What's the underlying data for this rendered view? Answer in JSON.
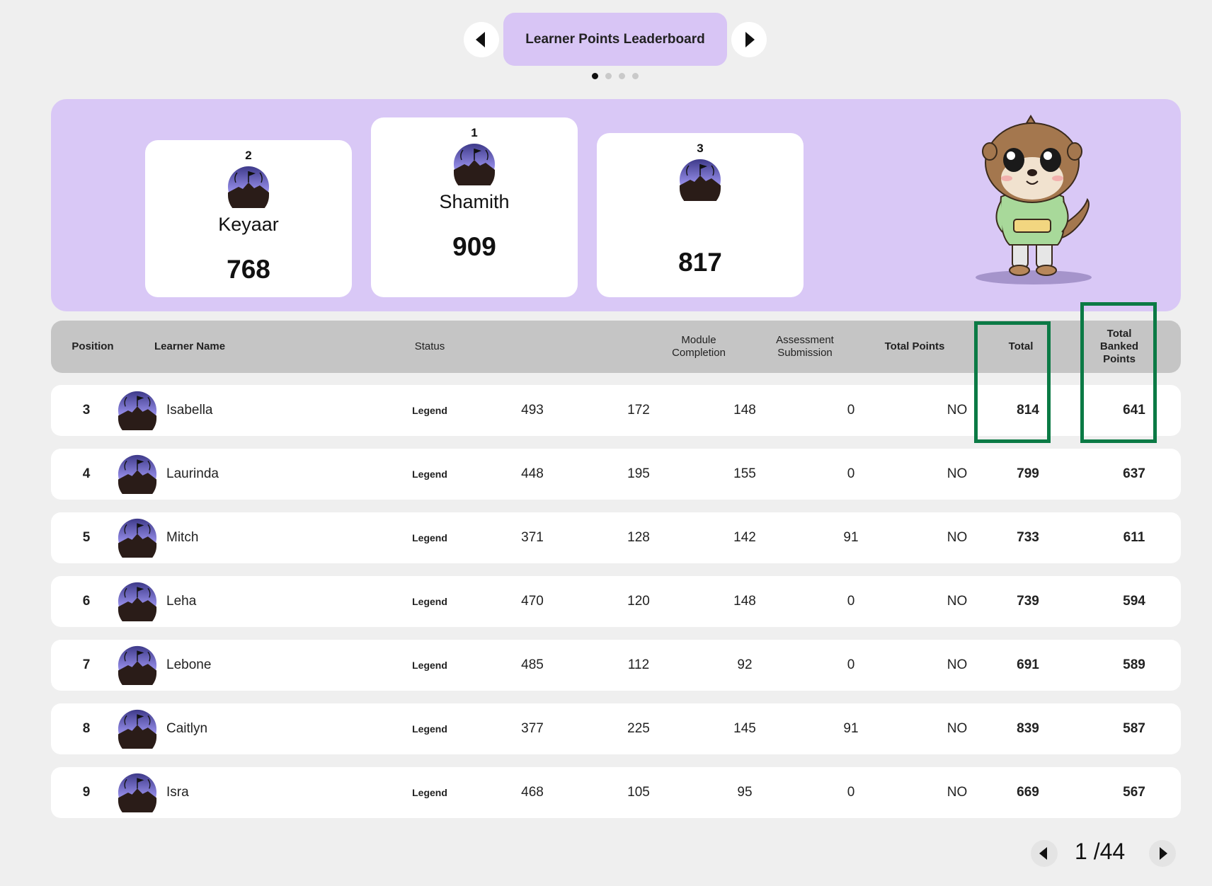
{
  "header": {
    "title": "Learner Points Leaderboard",
    "carousel_pages": 4,
    "carousel_active": 1
  },
  "podium": [
    {
      "rank": "2",
      "name": "Keyaar",
      "score": "768"
    },
    {
      "rank": "1",
      "name": "Shamith",
      "score": "909"
    },
    {
      "rank": "3",
      "name": "",
      "score": "817"
    }
  ],
  "table": {
    "columns": {
      "position": "Position",
      "learner_name": "Learner Name",
      "status": "Status",
      "module_completion": "Module Completion",
      "assessment_submission": "Assessment Submission",
      "total_points": "Total Points",
      "total": "Total",
      "total_banked_points": "Total Banked Points"
    },
    "rows": [
      {
        "position": "3",
        "name": "Isabella",
        "status": "Legend",
        "c1": "493",
        "c2": "172",
        "c3": "148",
        "c4": "0",
        "c5": "NO",
        "total": "814",
        "banked": "641"
      },
      {
        "position": "4",
        "name": "Laurinda",
        "status": "Legend",
        "c1": "448",
        "c2": "195",
        "c3": "155",
        "c4": "0",
        "c5": "NO",
        "total": "799",
        "banked": "637"
      },
      {
        "position": "5",
        "name": "Mitch",
        "status": "Legend",
        "c1": "371",
        "c2": "128",
        "c3": "142",
        "c4": "91",
        "c5": "NO",
        "total": "733",
        "banked": "611"
      },
      {
        "position": "6",
        "name": "Leha",
        "status": "Legend",
        "c1": "470",
        "c2": "120",
        "c3": "148",
        "c4": "0",
        "c5": "NO",
        "total": "739",
        "banked": "594"
      },
      {
        "position": "7",
        "name": "Lebone",
        "status": "Legend",
        "c1": "485",
        "c2": "112",
        "c3": "92",
        "c4": "0",
        "c5": "NO",
        "total": "691",
        "banked": "589"
      },
      {
        "position": "8",
        "name": "Caitlyn",
        "status": "Legend",
        "c1": "377",
        "c2": "225",
        "c3": "145",
        "c4": "91",
        "c5": "NO",
        "total": "839",
        "banked": "587"
      },
      {
        "position": "9",
        "name": "Isra",
        "status": "Legend",
        "c1": "468",
        "c2": "105",
        "c3": "95",
        "c4": "0",
        "c5": "NO",
        "total": "669",
        "banked": "567"
      }
    ]
  },
  "pagination": {
    "current": "1",
    "total": "/44"
  },
  "colors": {
    "accent_purple": "#d9c8f6",
    "highlight_green": "#0b7a45",
    "header_gray": "#c5c5c5"
  },
  "icons": {
    "avatar": "mountain-flag-avatar-icon",
    "mascot": "otter-mascot",
    "prev": "triangle-left-icon",
    "next": "triangle-right-icon"
  }
}
